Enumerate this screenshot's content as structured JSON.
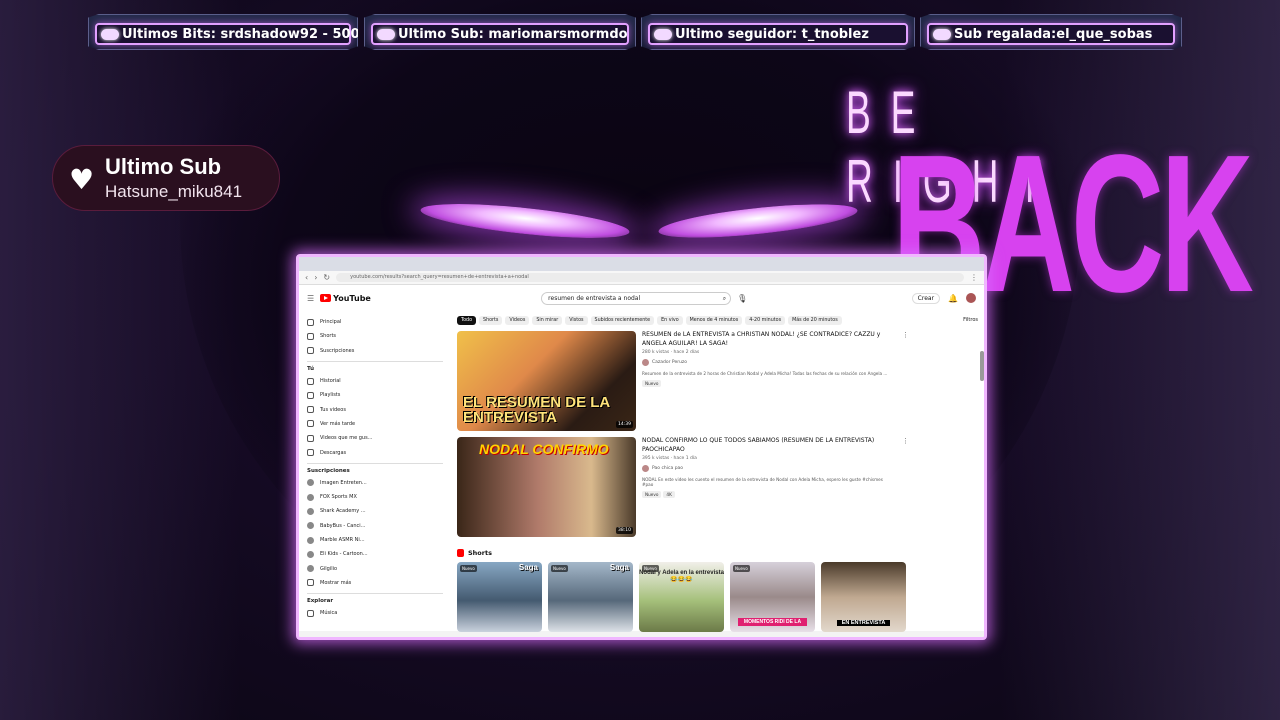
{
  "tickers": [
    {
      "text": "Ultimos Bits: srdshadow92 - 500"
    },
    {
      "text": "Ultimo Sub: mariomarsmormdo"
    },
    {
      "text": "Ultimo seguidor: t_tnoblez"
    },
    {
      "text": "Sub regalada:el_que_sobas"
    }
  ],
  "last_sub": {
    "title": "Ultimo Sub",
    "name": "Hatsune_miku841",
    "icon": "heart-icon"
  },
  "brb": {
    "line1": "BE RIGHT",
    "line2": "BACK"
  },
  "accent_colors": {
    "neon_purple": "#d742ef",
    "frame_glow": "#f0b6ff"
  },
  "browser": {
    "url": "youtube.com/results?search_query=resumen+de+entrevista+a+nodal"
  },
  "youtube": {
    "logo_text": "YouTube",
    "search_query": "resumen de entrevista a nodal",
    "create_label": "Crear",
    "sidebar": {
      "main": [
        "Principal",
        "Shorts",
        "Suscripciones"
      ],
      "you_label": "Tú",
      "you_items": [
        "Historial",
        "Playlists",
        "Tus videos",
        "Ver más tarde",
        "Videos que me gus...",
        "Descargas"
      ],
      "subs_label": "Suscripciones",
      "subs_items": [
        "Imagen Entreten...",
        "FOX Sports MX",
        "Shark Academy ...",
        "BabyBus - Canci...",
        "Marble ASMR Ni...",
        "Eli Kids - Cartoon...",
        "Gilgilio",
        "Mostrar más"
      ],
      "explore_label": "Explorar",
      "explore_items": [
        "Música"
      ]
    },
    "chips": [
      "Todo",
      "Shorts",
      "Videos",
      "Sin mirar",
      "Vistos",
      "Subidos recientemente",
      "En vivo",
      "Menos de 4 minutos",
      "4-20 minutos",
      "Más de 20 minutos"
    ],
    "filters_label": "Filtros",
    "videos": [
      {
        "thumb_text": "EL RESUMEN DE LA ENTREVISTA",
        "duration": "14:39",
        "title": "RESUMEN de LA ENTREVISTA a CHRISTIAN NODAL! ¿SE CONTRADICE? CAZZU y ANGELA AGUILAR! LA SAGA!",
        "meta": "280 k vistas · hace 2 días",
        "channel": "Cazador Peruzo",
        "desc": "Resumen de la entrevista de 2 horas de Christian Nodal y Adela Micha! Todas las fechas de su relación con Angela ...",
        "badge": "Nuevo"
      },
      {
        "thumb_text": "NODAL CONFIRMO",
        "duration": "38:10",
        "title": "NODAL CONFIRMO LO QUE TODOS SABIAMOS (RESUMEN DE LA ENTREVISTA) PAOCHICAPAO",
        "meta": "395 k vistas · hace 1 día",
        "channel": "Pao chica pao",
        "desc": "NODAL En este video les cuento el resumen de la entrevista de Nodal con Adela Micha, espero les guste #chismes #pao",
        "badge": "Nuevo",
        "badge2": "4K"
      }
    ],
    "shorts_label": "Shorts",
    "shorts": [
      {
        "tag": "Nuevo",
        "caption": "Saga"
      },
      {
        "tag": "Nuevo",
        "caption": "Saga"
      },
      {
        "tag": "Nuevo",
        "caption": "Nodal y Adela en la entrevista 😂😂😂"
      },
      {
        "tag": "Nuevo",
        "caption": "MOMENTOS RIDI DE LA"
      },
      {
        "tag": "",
        "caption": "EN ENTREVISTA"
      }
    ]
  }
}
